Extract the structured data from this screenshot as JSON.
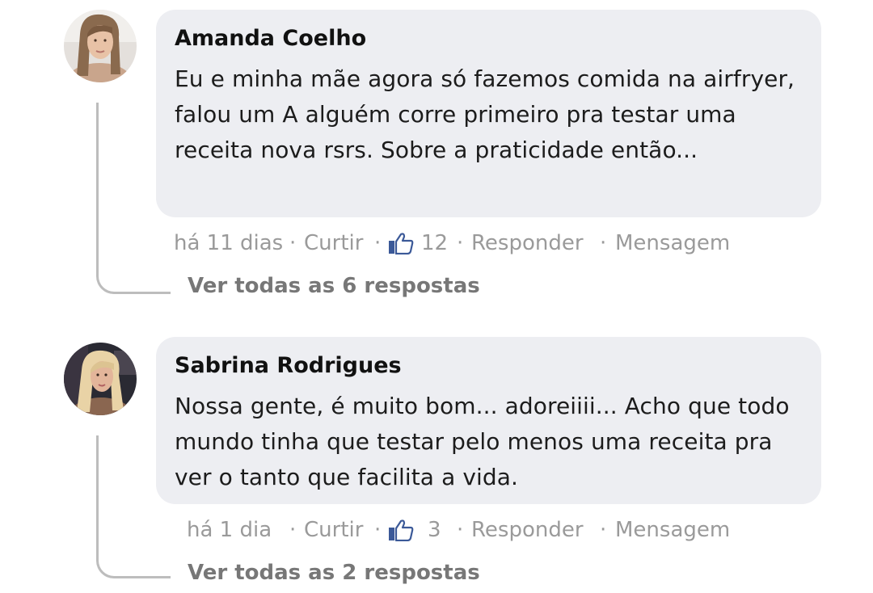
{
  "comments": [
    {
      "author": "Amanda Coelho",
      "text": "Eu e minha mãe agora só fazemos comida na airfryer, falou um A alguém corre primeiro pra testar uma receita nova rsrs. Sobre a praticidade então...",
      "time": "há 11 dias",
      "like_label": "Curtir",
      "like_count": "12",
      "reply_label": "Responder",
      "message_label": "Mensagem",
      "view_replies": "Ver todas as 6 respostas"
    },
    {
      "author": "Sabrina Rodrigues",
      "text": "Nossa gente, é muito bom... adoreiiii... Acho que todo mundo tinha que testar pelo menos uma receita pra ver o tanto que facilita a vida.",
      "time": "há 1 dia",
      "like_label": "Curtir",
      "like_count": "3",
      "reply_label": "Responder",
      "message_label": "Mensagem",
      "view_replies": "Ver todas as 2 respostas"
    }
  ],
  "separator": "·",
  "icons": {
    "like": "thumbs-up-icon"
  },
  "colors": {
    "like_icon": "#3b5998",
    "bubble": "#edeef2",
    "meta_text": "#9a9a9a"
  }
}
